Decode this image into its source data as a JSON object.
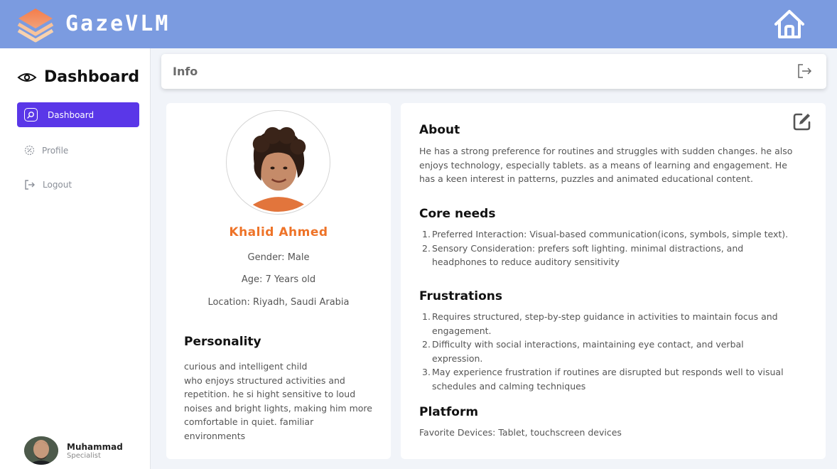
{
  "app": {
    "brand": "GazeVLM",
    "logo_icon": "layers-icon",
    "home_icon": "home-icon",
    "colors": {
      "topbar": "#7b9be0",
      "accent": "#5a37e8",
      "name": "#ee7328"
    }
  },
  "sidebar": {
    "title": "Dashboard",
    "title_icon": "eye-icon",
    "items": [
      {
        "label": "Dashboard",
        "icon": "dashboard-icon",
        "active": true
      },
      {
        "label": "Profile",
        "icon": "profile-icon",
        "active": false
      },
      {
        "label": "Logout",
        "icon": "logout-icon",
        "active": false
      }
    ],
    "user": {
      "name": "Muhammad",
      "role": "Specialist"
    }
  },
  "infobar": {
    "label": "Info",
    "exit_icon": "exit-icon"
  },
  "profile": {
    "name": "Khalid Ahmed",
    "gender": "Gender: Male",
    "age": "Age: 7 Years old",
    "location": "Location: Riyadh, Saudi Arabia",
    "personality": {
      "title": "Personality",
      "lines": [
        "curious and intelligent child",
        "who enjoys structured activities and",
        "repetition. he si hight sensitive to loud",
        "noises and bright lights, making him more",
        "comfortable in quiet. familiar",
        "environments"
      ]
    }
  },
  "details": {
    "edit_icon": "edit-icon",
    "about": {
      "title": "About",
      "lines": [
        "He has a strong preference for routines and struggles with sudden changes. he also",
        "enjoys technology, especially tablets. as a means of learning and engagement. He",
        "has a keen interest in patterns, puzzles and animated educational content."
      ]
    },
    "core_needs": {
      "title": "Core needs",
      "items": [
        {
          "num": "1.",
          "lines": [
            "Preferred Interaction: Visual-based communication(icons, symbols, simple text)."
          ]
        },
        {
          "num": "2.",
          "lines": [
            "Sensory Consideration: prefers soft lighting. minimal distractions, and",
            "headphones to reduce auditory sensitivity"
          ]
        }
      ]
    },
    "frustrations": {
      "title": "Frustrations",
      "items": [
        {
          "num": "1.",
          "lines": [
            "Requires structured, step-by-step guidance in activities to maintain focus and",
            "engagement."
          ]
        },
        {
          "num": "2.",
          "lines": [
            "Difficulty with social interactions, maintaining eye contact, and verbal",
            "expression."
          ]
        },
        {
          "num": "3.",
          "lines": [
            "May experience frustration if routines are disrupted but responds well to visual",
            "schedules and calming techniques"
          ]
        }
      ]
    },
    "platform": {
      "title": "Platform",
      "text": "Favorite Devices: Tablet, touchscreen devices"
    }
  }
}
